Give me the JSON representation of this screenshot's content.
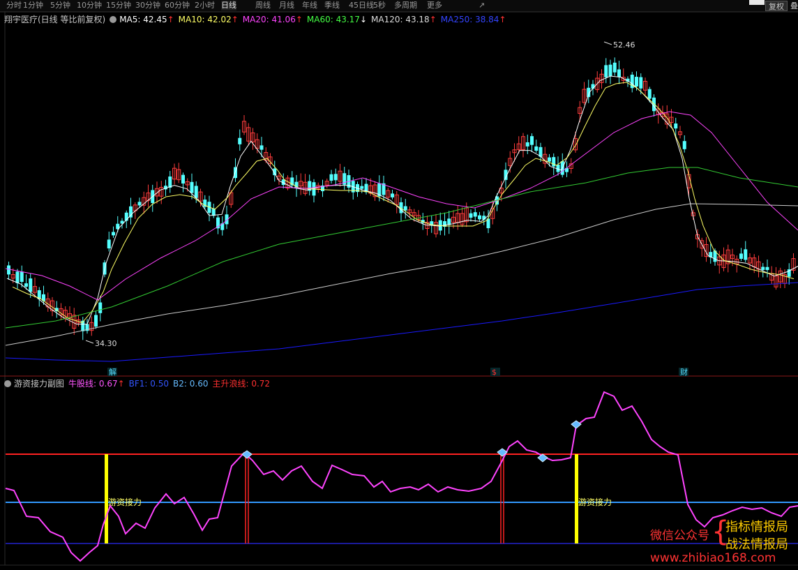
{
  "period_bar": {
    "tabs": [
      "分时",
      "1分钟",
      "5分钟",
      "10分钟",
      "15分钟",
      "30分钟",
      "60分钟",
      "2小时",
      "日线",
      "周线",
      "月线",
      "年线",
      "季线",
      "45日线",
      "5秒",
      "多周期",
      "更多"
    ],
    "selected": "日线",
    "more_chevron": "↗",
    "fuquan_button": "复权",
    "more_button": "叠"
  },
  "main_legend": {
    "title": "翔宇医疗(日线 等比前复权)",
    "items": [
      {
        "label": "MA5: 42.45",
        "arrow": "↑",
        "color": "#ffffff",
        "arrow_color": "#ff3030"
      },
      {
        "label": "MA10: 42.02",
        "arrow": "↑",
        "color": "#ffff66",
        "arrow_color": "#ff3030"
      },
      {
        "label": "MA20: 41.06",
        "arrow": "↑",
        "color": "#ff44ff",
        "arrow_color": "#ff3030"
      },
      {
        "label": "MA60: 43.17",
        "arrow": "↓",
        "color": "#44ff44",
        "arrow_color": "#ffffff"
      },
      {
        "label": "MA120: 43.18",
        "arrow": "↑",
        "color": "#dddddd",
        "arrow_color": "#ff3030"
      },
      {
        "label": "MA250: 38.84",
        "arrow": "↑",
        "color": "#3344ff",
        "arrow_color": "#ff3030"
      }
    ]
  },
  "sub_legend": {
    "title": "游资接力副图",
    "items": [
      {
        "label": "牛股线: 0.67",
        "arrow": "↑",
        "color": "#ff55ff",
        "arrow_color": "#ff3030"
      },
      {
        "label": "BF1: 0.50",
        "arrow": "",
        "color": "#3355ff",
        "arrow_color": ""
      },
      {
        "label": "B2: 0.60",
        "arrow": "",
        "color": "#66bbff",
        "arrow_color": ""
      },
      {
        "label": "主升浪线: 0.72",
        "arrow": "",
        "color": "#ff3030",
        "arrow_color": ""
      }
    ]
  },
  "annotations": {
    "high_label": "52.46",
    "low_label": "34.30",
    "event_markers": [
      {
        "label": "解",
        "color": "#55ddff"
      },
      {
        "label": "$",
        "color": "#ff3030"
      },
      {
        "label": "财",
        "color": "#55ddff"
      }
    ],
    "signal_labels": [
      "游资接力",
      "游资接力"
    ]
  },
  "watermark": {
    "wechat_label": "微信公众号",
    "name_line1": "指标情报局",
    "name_line2": "战法情报局",
    "url": "www.zhibiao168.com"
  },
  "colors": {
    "up": "#ff3d3d",
    "down": "#54ffff",
    "ma5": "#ffffff",
    "ma10": "#ffff66",
    "ma20": "#ff44ff",
    "ma60": "#33cc33",
    "ma120": "#cccccc",
    "ma250": "#1a1aff",
    "bull_line": "#ff44ff",
    "level_red": "#ff2222",
    "level_cyan": "#3399ff",
    "level_blue": "#2222cc",
    "signal_yellow": "#ffff00"
  }
}
